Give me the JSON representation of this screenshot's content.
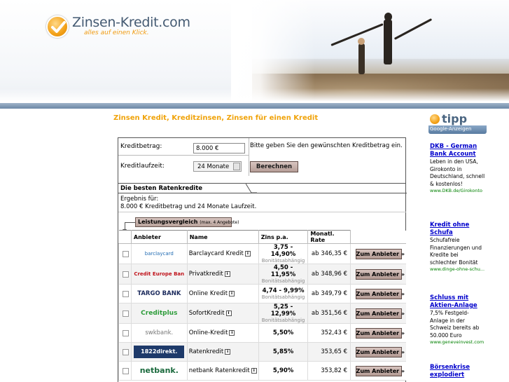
{
  "header": {
    "logo_title": "Zinsen-Kredit.com",
    "logo_slogan": "alles auf einen Klick."
  },
  "page_heading": "Zinsen Kredit, Kreditzinsen, Zinsen für einen Kredit",
  "calculator": {
    "amount_label": "Kreditbetrag:",
    "amount_value": "8.000 €",
    "duration_label": "Kreditlaufzeit:",
    "duration_value": "24 Monate",
    "hint": "Bitte geben Sie den gewünschten Kreditbetrag ein.",
    "calculate_label": "Berechnen"
  },
  "results": {
    "heading": "Die besten Ratenkredite",
    "result_label": "Ergebnis für:",
    "result_text": "8.000 € Kreditbetrag und 24 Monate Laufzeit.",
    "compare_label": "Leistungsvergleich",
    "compare_note": "(max. 4 Angebote)",
    "columns": [
      "Anbieter",
      "Name",
      "Zins p.a.",
      "Monatl. Rate"
    ],
    "offers": [
      {
        "provider": "barclaycard",
        "name": "Barclaycard Kredit",
        "rate": "3,75 - 14,90%",
        "rate_note": "Bonitätsabhängig",
        "monthly": "ab 346,35 €",
        "button": "Zum Anbieter »"
      },
      {
        "provider": "Credit Europe Bank",
        "name": "Privatkredit",
        "rate": "4,50 - 11,95%",
        "rate_note": "Bonitätsabhängig",
        "monthly": "ab 348,96 €",
        "button": "Zum Anbieter »"
      },
      {
        "provider": "TARGO BANK",
        "name": "Online Kredit",
        "rate": "4,74 - 9,99%",
        "rate_note": "Bonitätsabhängig",
        "monthly": "ab 349,79 €",
        "button": "Zum Anbieter »"
      },
      {
        "provider": "Creditplus",
        "name": "SofortKredit",
        "rate": "5,25 - 12,99%",
        "rate_note": "Bonitätsabhängig",
        "monthly": "ab 351,56 €",
        "button": "Zum Anbieter »"
      },
      {
        "provider": "swkbank.",
        "name": "Online-Kredit",
        "rate": "5,50%",
        "rate_note": "",
        "monthly": "352,43 €",
        "button": "Zum Anbieter »"
      },
      {
        "provider": "1822direkt.",
        "name": "Ratenkredit",
        "rate": "5,85%",
        "rate_note": "",
        "monthly": "353,65 €",
        "button": "Zum Anbieter »"
      },
      {
        "provider": "netbank.",
        "name": "netbank Ratenkredit",
        "rate": "5,90%",
        "rate_note": "",
        "monthly": "353,82 €",
        "button": "Zum Anbieter »"
      }
    ]
  },
  "sidebar": {
    "tipp_label": "tipp",
    "ads_label": "Google-Anzeigen",
    "ads": [
      {
        "title": "DKB - German Bank Account",
        "body": "Leben in den USA, Girokonto in Deutschland, schnell & kostenlos!",
        "url": "www.DKB.de/Girokonto"
      },
      {
        "title": "Kredit ohne Schufa",
        "body": "Schufafreie Finanzierungen und Kredite bei schlechter Bonität",
        "url": "www.dinge-ohne-schu..."
      },
      {
        "title": "Schluss mit Aktien-Anlage",
        "body": "7,5% Festgeld-Anlage in der Schweiz bereits ab 50.000 Euro",
        "url": "www.geneveinvest.com"
      },
      {
        "title": "Börsenkrise explodiert",
        "body": "",
        "url": ""
      }
    ]
  },
  "colors": {
    "accent_orange": "#f0a30a",
    "link_blue": "#0000cc",
    "button_mauve": "#b59d96"
  }
}
